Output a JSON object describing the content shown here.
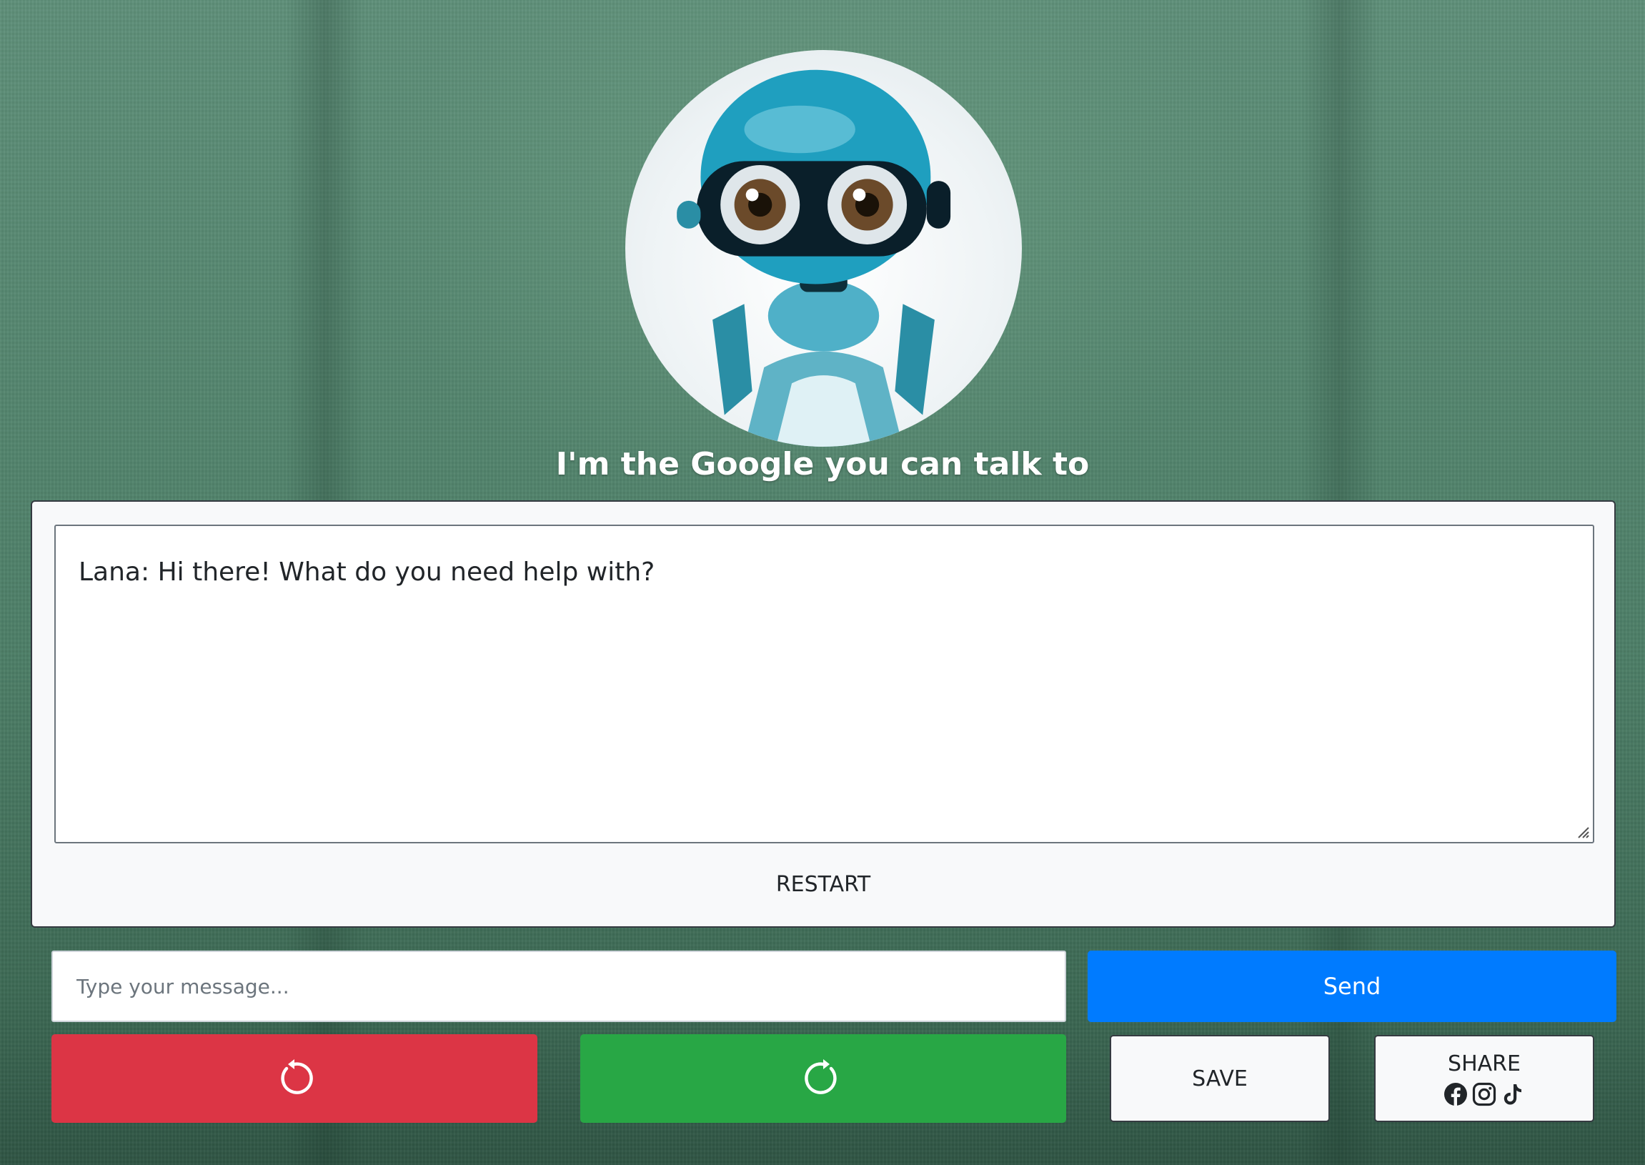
{
  "header": {
    "tagline": "I'm the Google you can talk to",
    "avatar_icon": "robot-avatar"
  },
  "chat": {
    "messages": [
      {
        "text": "Lana: Hi there! What do you need help with?"
      }
    ],
    "restart_label": "RESTART"
  },
  "composer": {
    "placeholder": "Type your message...",
    "value": "",
    "send_label": "Send"
  },
  "actions": {
    "undo_icon": "undo-arrow-icon",
    "redo_icon": "redo-arrow-icon",
    "save_label": "SAVE",
    "share_label": "SHARE",
    "share_icons": [
      "facebook-icon",
      "instagram-icon",
      "tiktok-icon"
    ]
  },
  "colors": {
    "send": "#007bff",
    "undo": "#dc3545",
    "redo": "#28a745",
    "background": "#4e8068"
  }
}
